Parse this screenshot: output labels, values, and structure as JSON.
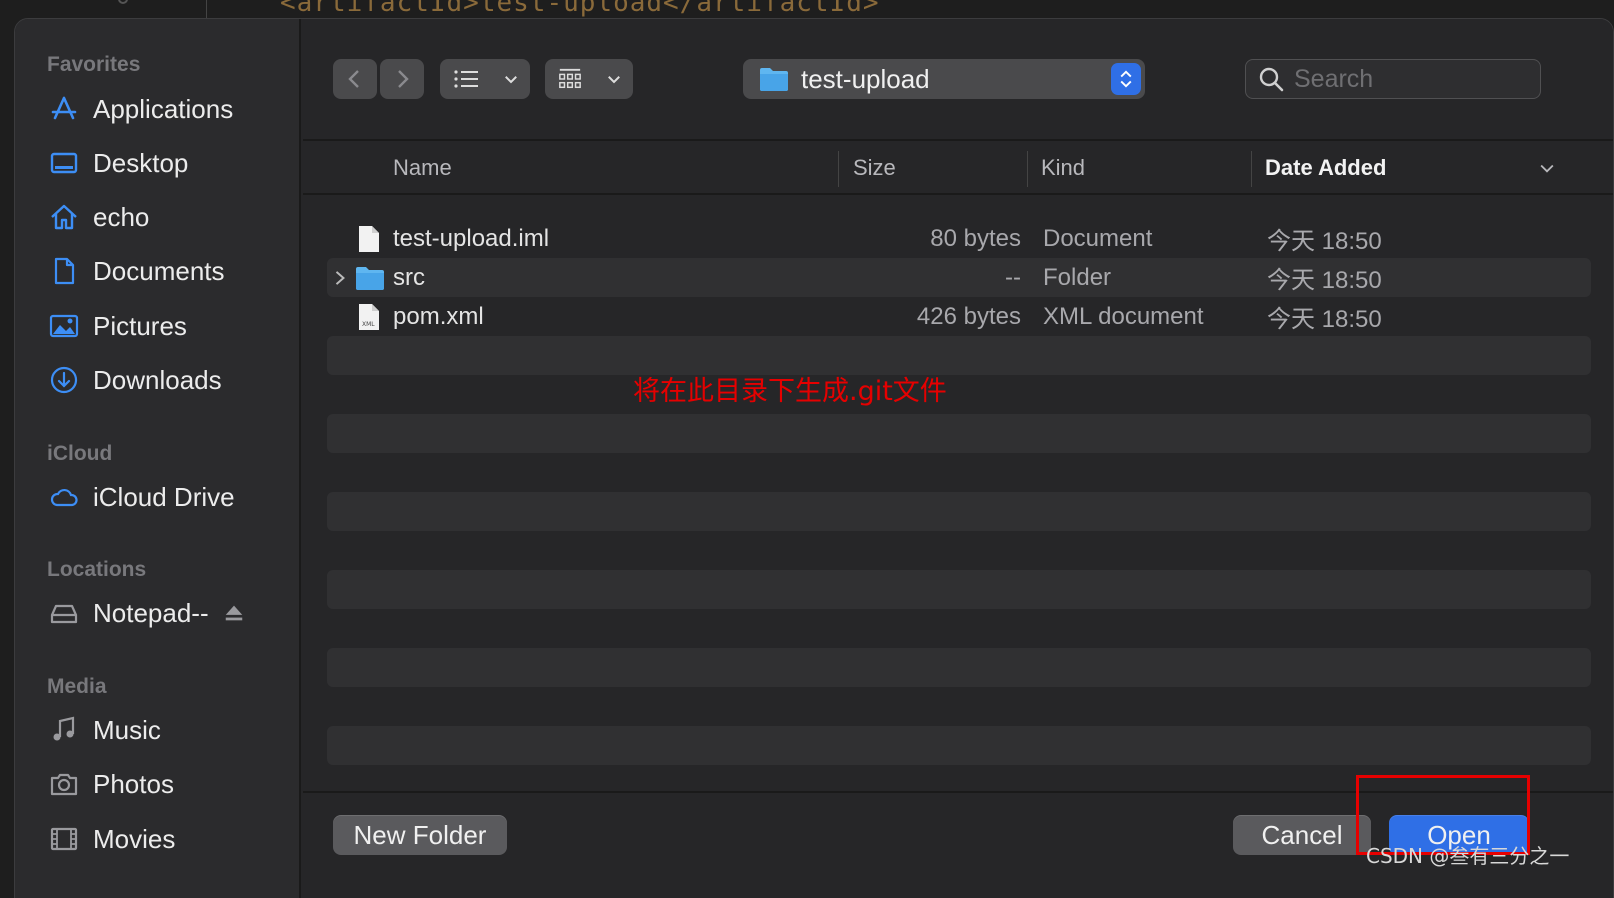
{
  "background_code": "<artifactId>test-upload</artifactId>",
  "sidebar": {
    "sections": [
      {
        "title": "Favorites"
      },
      {
        "title": "iCloud"
      },
      {
        "title": "Locations"
      },
      {
        "title": "Media"
      }
    ],
    "items": [
      {
        "label": "Applications",
        "icon": "applications-icon"
      },
      {
        "label": "Desktop",
        "icon": "desktop-icon"
      },
      {
        "label": "echo",
        "icon": "home-icon"
      },
      {
        "label": "Documents",
        "icon": "document-icon"
      },
      {
        "label": "Pictures",
        "icon": "pictures-icon"
      },
      {
        "label": "Downloads",
        "icon": "downloads-icon"
      },
      {
        "label": "iCloud Drive",
        "icon": "cloud-icon"
      },
      {
        "label": "Notepad--",
        "icon": "disk-icon"
      },
      {
        "label": "Music",
        "icon": "music-icon"
      },
      {
        "label": "Photos",
        "icon": "camera-icon"
      },
      {
        "label": "Movies",
        "icon": "film-icon"
      }
    ]
  },
  "toolbar": {
    "current_folder": "test-upload",
    "search_placeholder": "Search"
  },
  "table": {
    "columns": [
      "Name",
      "Size",
      "Kind",
      "Date Added"
    ],
    "sorted_column": "Date Added",
    "rows": [
      {
        "name": "test-upload.iml",
        "size": "80 bytes",
        "kind": "Document",
        "date": "今天 18:50",
        "icon": "document-file-icon"
      },
      {
        "name": "src",
        "size": "--",
        "kind": "Folder",
        "date": "今天 18:50",
        "icon": "folder-icon"
      },
      {
        "name": "pom.xml",
        "size": "426 bytes",
        "kind": "XML document",
        "date": "今天 18:50",
        "icon": "xml-file-icon"
      }
    ]
  },
  "annotation": "将在此目录下生成.git文件",
  "buttons": {
    "new_folder": "New Folder",
    "cancel": "Cancel",
    "open": "Open"
  },
  "watermark": "CSDN @叁有三分之一",
  "colors": {
    "accent": "#2f6fe6",
    "annotation": "#e60000",
    "sidebar_icon": "#3d8ef5"
  }
}
